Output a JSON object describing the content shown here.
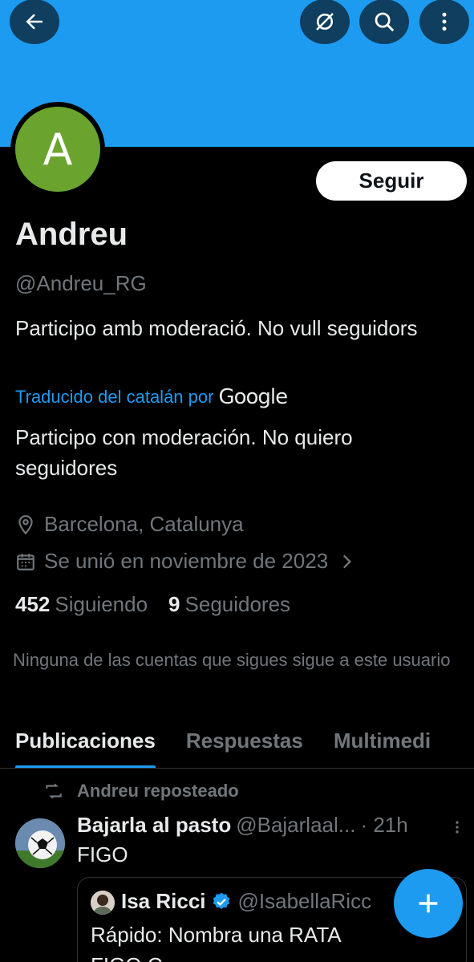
{
  "profile": {
    "avatar_letter": "A",
    "name": "Andreu",
    "handle": "@Andreu_RG",
    "bio": "Participo amb moderació. No vull seguidors",
    "translated_by": "Traducido del catalán por",
    "translator_brand": "Google",
    "bio_translated": "Participo con moderación. No quiero seguidores",
    "location": "Barcelona, Catalunya",
    "joined": "Se unió en noviembre de 2023",
    "following_count": "452",
    "following_label": "Siguiendo",
    "followers_count": "9",
    "followers_label": "Seguidores",
    "mutual_note": "Ninguna de las cuentas que sigues sigue a este usuario"
  },
  "header": {
    "follow_label": "Seguir",
    "icons": [
      "back-arrow-icon",
      "grok-icon",
      "search-icon",
      "more-vertical-icon"
    ]
  },
  "tabs": [
    {
      "label": "Publicaciones",
      "active": true
    },
    {
      "label": "Respuestas",
      "active": false
    },
    {
      "label": "Multimedi",
      "active": false
    }
  ],
  "timeline": {
    "repost_label": "Andreu reposteado",
    "post": {
      "author": "Bajarla al pasto",
      "handle": "@Bajarlaal...",
      "time": "· 21h",
      "text": "FIGO",
      "quote": {
        "author": "Isa Ricci",
        "handle": "@IsabellaRicc",
        "text": "Rápido: Nombra una RATA",
        "text2": "FIGO C..."
      }
    }
  },
  "colors": {
    "banner": "#1d9bf0",
    "avatar": "#6aa42f",
    "accent": "#1d9bf0",
    "background": "#000000"
  }
}
